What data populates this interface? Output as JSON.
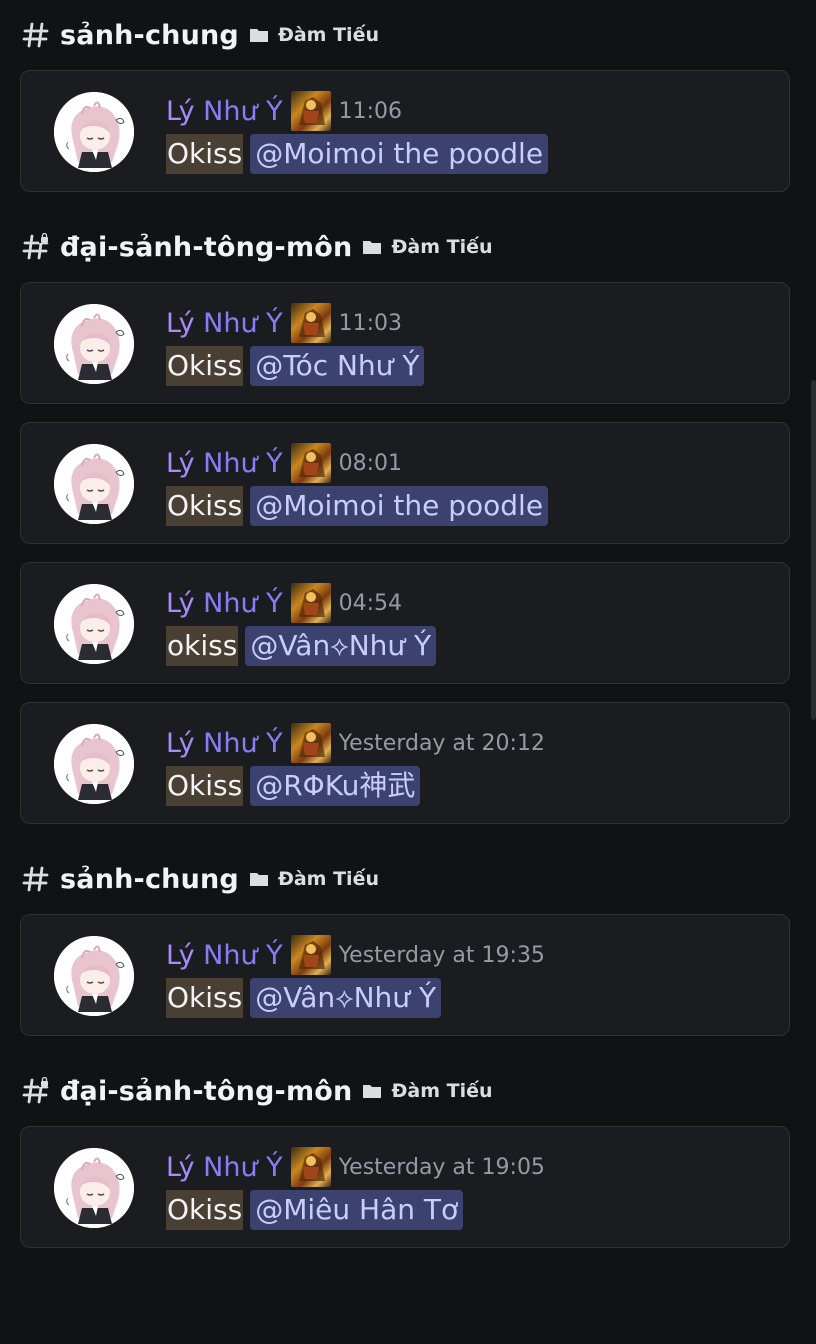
{
  "groups": [
    {
      "channel": "sảnh-chung",
      "channel_type": "text",
      "category": "Đàm Tiếu",
      "messages": [
        {
          "author_first": "Lý",
          "author_rest": " Như Ý",
          "time": "11:06",
          "text": "Okiss",
          "mention": "@Moimoi the poodle"
        }
      ]
    },
    {
      "channel": "đại-sảnh-tông-môn",
      "channel_type": "locked",
      "category": "Đàm Tiếu",
      "messages": [
        {
          "author_first": "Lý",
          "author_rest": " Như Ý",
          "time": "11:03",
          "text": "Okiss",
          "mention": "@Tóc Như Ý"
        },
        {
          "author_first": "Lý",
          "author_rest": " Như Ý",
          "time": "08:01",
          "text": "Okiss",
          "mention": "@Moimoi the poodle"
        },
        {
          "author_first": "Lý",
          "author_rest": " Như Ý",
          "time": "04:54",
          "text": "okiss",
          "mention": "@Vân⟡Như  Ý"
        },
        {
          "author_first": "Lý",
          "author_rest": " Như Ý",
          "time": "Yesterday at 20:12",
          "text": "Okiss",
          "mention": "@RΦKu神武"
        }
      ]
    },
    {
      "channel": "sảnh-chung",
      "channel_type": "text",
      "category": "Đàm Tiếu",
      "messages": [
        {
          "author_first": "Lý",
          "author_rest": " Như Ý",
          "time": "Yesterday at 19:35",
          "text": "Okiss",
          "mention": "@Vân⟡Như  Ý"
        }
      ]
    },
    {
      "channel": "đại-sảnh-tông-môn",
      "channel_type": "locked",
      "category": "Đàm Tiếu",
      "messages": [
        {
          "author_first": "Lý",
          "author_rest": " Như Ý",
          "time": "Yesterday at 19:05",
          "text": "Okiss",
          "mention": "@Miêu Hân Tơ"
        }
      ]
    }
  ],
  "icons": {
    "channel_text": "hashtag-icon",
    "channel_locked": "hashtag-lock-icon",
    "category": "folder-icon",
    "role": "role-badge-icon"
  },
  "colors": {
    "background": "#111214",
    "card": "#1b1c1f",
    "author": "#a78bfa",
    "timestamp": "#949ba4",
    "mention_bg": "#3c4270",
    "mention_text": "#c9cdfb",
    "highlight_bg": "#4a3f33"
  }
}
